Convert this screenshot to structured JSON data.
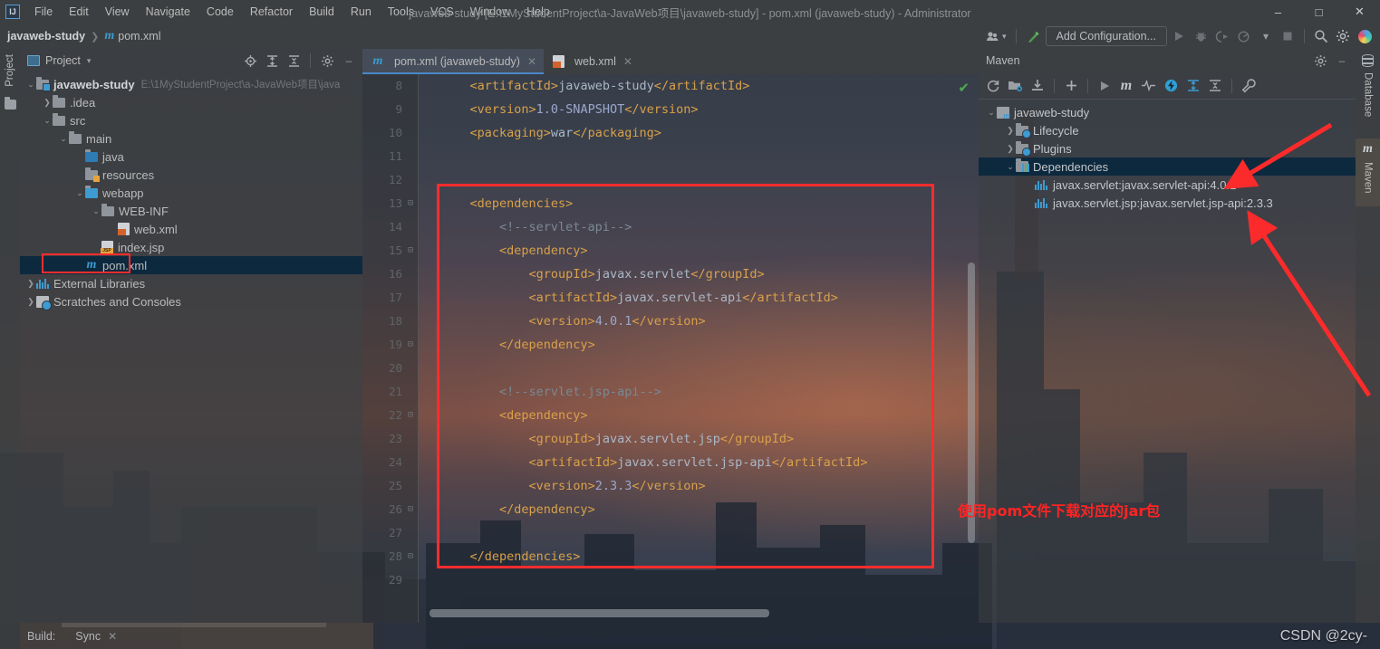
{
  "window": {
    "title": "javaweb-study [E:\\1MyStudentProject\\a-JavaWeb项目\\javaweb-study] - pom.xml (javaweb-study) - Administrator",
    "logo": "IJ",
    "minimize": "–",
    "maximize": "□",
    "close": "✕"
  },
  "menu": [
    "File",
    "Edit",
    "View",
    "Navigate",
    "Code",
    "Refactor",
    "Build",
    "Run",
    "Tools",
    "VCS",
    "Window",
    "Help"
  ],
  "navbar": {
    "breadcrumb_project": "javaweb-study",
    "breadcrumb_sep": "❯",
    "breadcrumb_file": "pom.xml",
    "m_glyph": "m",
    "add_configuration": "Add Configuration...",
    "icons": {
      "user": "share-icon",
      "hammer": "build-icon",
      "run": "▶",
      "debug": "debug-icon",
      "coverage": "coverage-icon",
      "profile": "profile-icon",
      "dropdown": "▾",
      "stop": "■",
      "search": "search-icon",
      "settings": "gear-icon",
      "ij": "ij-gradient-icon"
    }
  },
  "left_strip": {
    "project_tab": "Project"
  },
  "right_strip": {
    "database_tab": "Database",
    "maven_tab": "Maven",
    "maven_glyph": "m"
  },
  "project_panel": {
    "title": "Project",
    "dropdown": "▾",
    "actions": {
      "locate": "locate-icon",
      "expand": "expand-all-icon",
      "collapse": "collapse-all-icon",
      "settings": "gear-icon",
      "hide": "–"
    },
    "tree": [
      {
        "label": "javaweb-study",
        "path": "E:\\1MyStudentProject\\a-JavaWeb项目\\java",
        "indent": 0,
        "arrow": "v",
        "icon": "module-folder",
        "bold": true
      },
      {
        "label": ".idea",
        "path": "",
        "indent": 1,
        "arrow": ">",
        "icon": "folder",
        "bold": false
      },
      {
        "label": "src",
        "path": "",
        "indent": 1,
        "arrow": "v",
        "icon": "folder",
        "bold": false
      },
      {
        "label": "main",
        "path": "",
        "indent": 2,
        "arrow": "v",
        "icon": "folder",
        "bold": false
      },
      {
        "label": "java",
        "path": "",
        "indent": 3,
        "arrow": "",
        "icon": "sources-folder",
        "bold": false
      },
      {
        "label": "resources",
        "path": "",
        "indent": 3,
        "arrow": "",
        "icon": "resources-folder",
        "bold": false
      },
      {
        "label": "webapp",
        "path": "",
        "indent": 3,
        "arrow": "v",
        "icon": "webapp-folder",
        "bold": false
      },
      {
        "label": "WEB-INF",
        "path": "",
        "indent": 4,
        "arrow": "v",
        "icon": "folder",
        "bold": false
      },
      {
        "label": "web.xml",
        "path": "",
        "indent": 5,
        "arrow": "",
        "icon": "xml-file",
        "bold": false
      },
      {
        "label": "index.jsp",
        "path": "",
        "indent": 4,
        "arrow": "",
        "icon": "jsp-file",
        "bold": false
      },
      {
        "label": "pom.xml",
        "path": "",
        "indent": 3,
        "arrow": "",
        "icon": "maven-file",
        "bold": false,
        "selected": true,
        "highlighted": true
      },
      {
        "label": "External Libraries",
        "path": "",
        "indent": 0,
        "arrow": ">",
        "icon": "library-icon",
        "bold": false
      },
      {
        "label": "Scratches and Consoles",
        "path": "",
        "indent": 0,
        "arrow": ">",
        "icon": "scratch-icon",
        "bold": false
      }
    ]
  },
  "editor": {
    "tabs": [
      {
        "label": "pom.xml (javaweb-study)",
        "icon": "maven-file",
        "active": true,
        "close": "✕"
      },
      {
        "label": "web.xml",
        "icon": "xml-file",
        "active": false,
        "close": "✕"
      }
    ],
    "inspection_ok": "✔",
    "lines": [
      {
        "n": "8",
        "fold": "",
        "text": "    <artifactId>javaweb-study</artifactId>"
      },
      {
        "n": "9",
        "fold": "",
        "text": "    <version>1.0-SNAPSHOT</version>"
      },
      {
        "n": "10",
        "fold": "",
        "text": "    <packaging>war</packaging>"
      },
      {
        "n": "11",
        "fold": "",
        "text": ""
      },
      {
        "n": "12",
        "fold": "",
        "text": ""
      },
      {
        "n": "13",
        "fold": "−",
        "text": "    <dependencies>"
      },
      {
        "n": "14",
        "fold": "",
        "text": "        <!--servlet-api-->"
      },
      {
        "n": "15",
        "fold": "−",
        "text": "        <dependency>"
      },
      {
        "n": "16",
        "fold": "",
        "text": "            <groupId>javax.servlet</groupId>"
      },
      {
        "n": "17",
        "fold": "",
        "text": "            <artifactId>javax.servlet-api</artifactId>"
      },
      {
        "n": "18",
        "fold": "",
        "text": "            <version>4.0.1</version>"
      },
      {
        "n": "19",
        "fold": "−",
        "text": "        </dependency>"
      },
      {
        "n": "20",
        "fold": "",
        "text": ""
      },
      {
        "n": "21",
        "fold": "",
        "text": "        <!--servlet.jsp-api-->"
      },
      {
        "n": "22",
        "fold": "−",
        "text": "        <dependency>"
      },
      {
        "n": "23",
        "fold": "",
        "text": "            <groupId>javax.servlet.jsp</groupId>"
      },
      {
        "n": "24",
        "fold": "",
        "text": "            <artifactId>javax.servlet.jsp-api</artifactId>"
      },
      {
        "n": "25",
        "fold": "",
        "text": "            <version>2.3.3</version>"
      },
      {
        "n": "26",
        "fold": "−",
        "text": "        </dependency>"
      },
      {
        "n": "27",
        "fold": "",
        "text": ""
      },
      {
        "n": "28",
        "fold": "−",
        "text": "    </dependencies>"
      },
      {
        "n": "29",
        "fold": "",
        "text": ""
      }
    ]
  },
  "maven_panel": {
    "title": "Maven",
    "actions": {
      "settings": "gear-icon",
      "hide": "–"
    },
    "toolbar": [
      "reload-icon",
      "generate-sources-icon",
      "download-sources-icon",
      "add-icon",
      "run-icon",
      "maven-goal-icon",
      "toggle-skip-tests-icon",
      "offline-mode-icon",
      "expand-all-icon",
      "collapse-all-icon",
      "maven-settings-icon"
    ],
    "tree": [
      {
        "label": "javaweb-study",
        "indent": 0,
        "arrow": "v",
        "icon": "maven-project-icon"
      },
      {
        "label": "Lifecycle",
        "indent": 1,
        "arrow": ">",
        "icon": "lifecycle-folder-icon"
      },
      {
        "label": "Plugins",
        "indent": 1,
        "arrow": ">",
        "icon": "plugins-folder-icon"
      },
      {
        "label": "Dependencies",
        "indent": 1,
        "arrow": "v",
        "icon": "dependencies-folder-icon",
        "selected": true
      },
      {
        "label": "javax.servlet:javax.servlet-api:4.0.1",
        "indent": 2,
        "arrow": "",
        "icon": "dependency-bars-icon"
      },
      {
        "label": "javax.servlet.jsp:javax.servlet.jsp-api:2.3.3",
        "indent": 2,
        "arrow": "",
        "icon": "dependency-bars-icon"
      }
    ]
  },
  "annotations": {
    "note_text": "使用pom文件下载对应的jar包",
    "note_color": "#ff2424",
    "box_color": "#ff2d2d"
  },
  "statusbar": {
    "build_label": "Build:",
    "sync_label": "Sync",
    "sync_close": "✕"
  },
  "watermark": "CSDN @2cy-"
}
